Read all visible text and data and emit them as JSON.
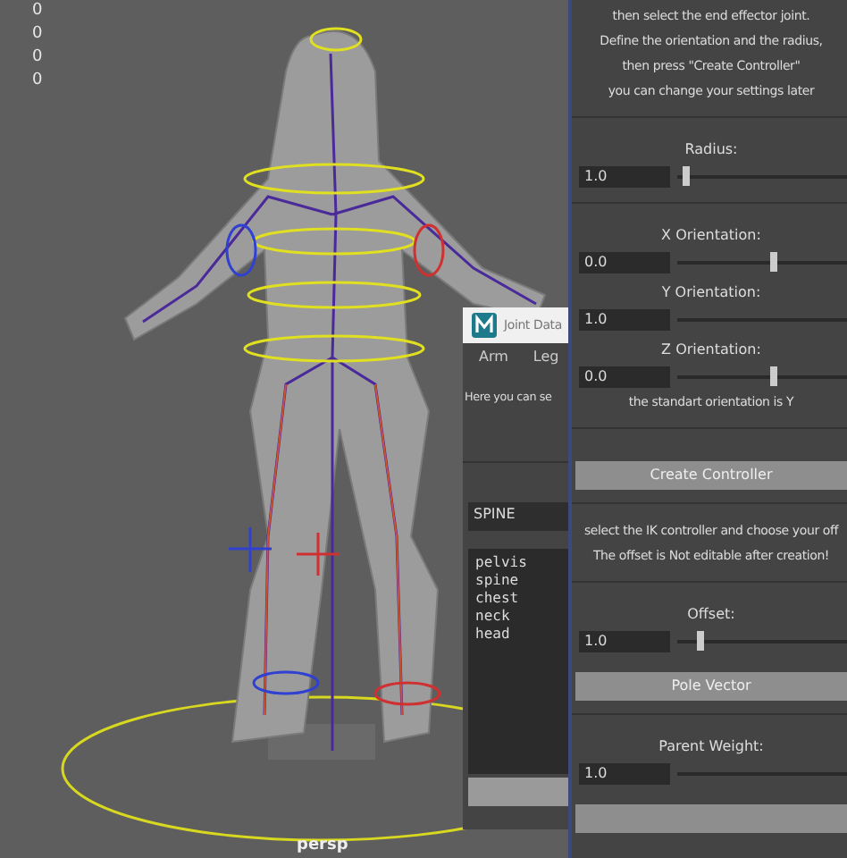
{
  "viewport": {
    "hud_values": [
      "0",
      "0",
      "0",
      "0"
    ],
    "camera_label": "persp"
  },
  "joint_window": {
    "title": "Joint Data",
    "tabs": [
      "Arm",
      "Leg"
    ],
    "hint": "Here you can se",
    "dropdown": {
      "value": "SPINE"
    },
    "joints": [
      "pelvis",
      "spine",
      "chest",
      "neck",
      "head"
    ]
  },
  "panel": [
    {
      "kind": "text",
      "text": "then select the end effector joint."
    },
    {
      "kind": "text",
      "text": "Define the orientation and the radius,"
    },
    {
      "kind": "text",
      "text": "then press \"Create Controller\""
    },
    {
      "kind": "text",
      "text": "you can change your settings later"
    },
    {
      "kind": "divider"
    },
    {
      "kind": "label",
      "text": "Radius:"
    },
    {
      "kind": "slider",
      "value": "1.0",
      "level": 0.03
    },
    {
      "kind": "divider"
    },
    {
      "kind": "label",
      "text": "X Orientation:"
    },
    {
      "kind": "slider",
      "value": "0.0",
      "level": 0.54
    },
    {
      "kind": "label",
      "text": "Y Orientation:"
    },
    {
      "kind": "slider",
      "value": "1.0"
    },
    {
      "kind": "label",
      "text": "Z Orientation:"
    },
    {
      "kind": "slider",
      "value": "0.0",
      "level": 0.54
    },
    {
      "kind": "text",
      "text": "the standart orientation is Y"
    },
    {
      "kind": "divider"
    },
    {
      "kind": "button",
      "label": "Create Controller"
    },
    {
      "kind": "divider"
    },
    {
      "kind": "text",
      "text": "select the IK controller and choose your off"
    },
    {
      "kind": "text",
      "text": "The offset is Not editable after creation!"
    },
    {
      "kind": "divider"
    },
    {
      "kind": "label",
      "text": "Offset:"
    },
    {
      "kind": "slider",
      "value": "1.0",
      "level": 0.11
    },
    {
      "kind": "button",
      "label": "Pole Vector"
    },
    {
      "kind": "divider"
    },
    {
      "kind": "label",
      "text": "Parent Weight:"
    },
    {
      "kind": "slider",
      "value": "1.0"
    },
    {
      "kind": "button"
    }
  ]
}
